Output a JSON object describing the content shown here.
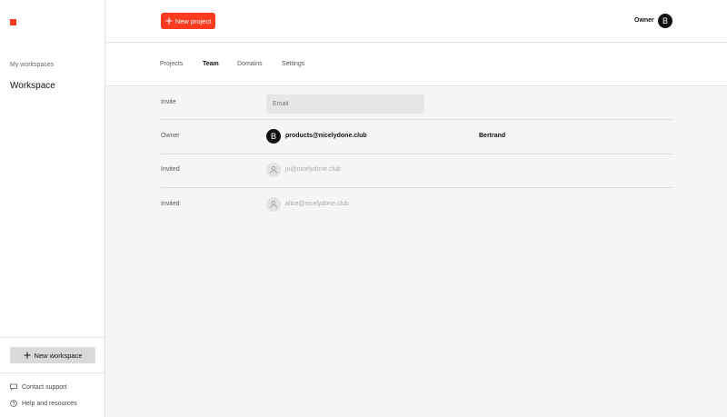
{
  "sidebar": {
    "brand_color": "#ff3b1f",
    "section_label": "My workspaces",
    "workspace_name": "Workspace",
    "new_workspace_label": "New workspace",
    "links": [
      {
        "icon": "chat-bubble-icon",
        "label": "Contact support"
      },
      {
        "icon": "help-circle-icon",
        "label": "Help and resources"
      }
    ]
  },
  "topbar": {
    "new_project_label": "New project",
    "role_label": "Owner",
    "avatar_initial": "B"
  },
  "tabs": [
    {
      "label": "Projects",
      "active": false
    },
    {
      "label": "Team",
      "active": true
    },
    {
      "label": "Domains",
      "active": false
    },
    {
      "label": "Settings",
      "active": false
    }
  ],
  "invite": {
    "label": "Invite",
    "email_placeholder": "Email",
    "email_value": ""
  },
  "members": [
    {
      "role": "Owner",
      "avatar_initial": "B",
      "email": "products@nicelydone.club",
      "name": "Bertrand"
    },
    {
      "role": "Invited",
      "avatar_icon": "user-icon",
      "email": "jo@nicelydone.club",
      "name": ""
    },
    {
      "role": "Invited",
      "avatar_icon": "user-icon",
      "email": "alice@nicelydone.club",
      "name": ""
    }
  ]
}
